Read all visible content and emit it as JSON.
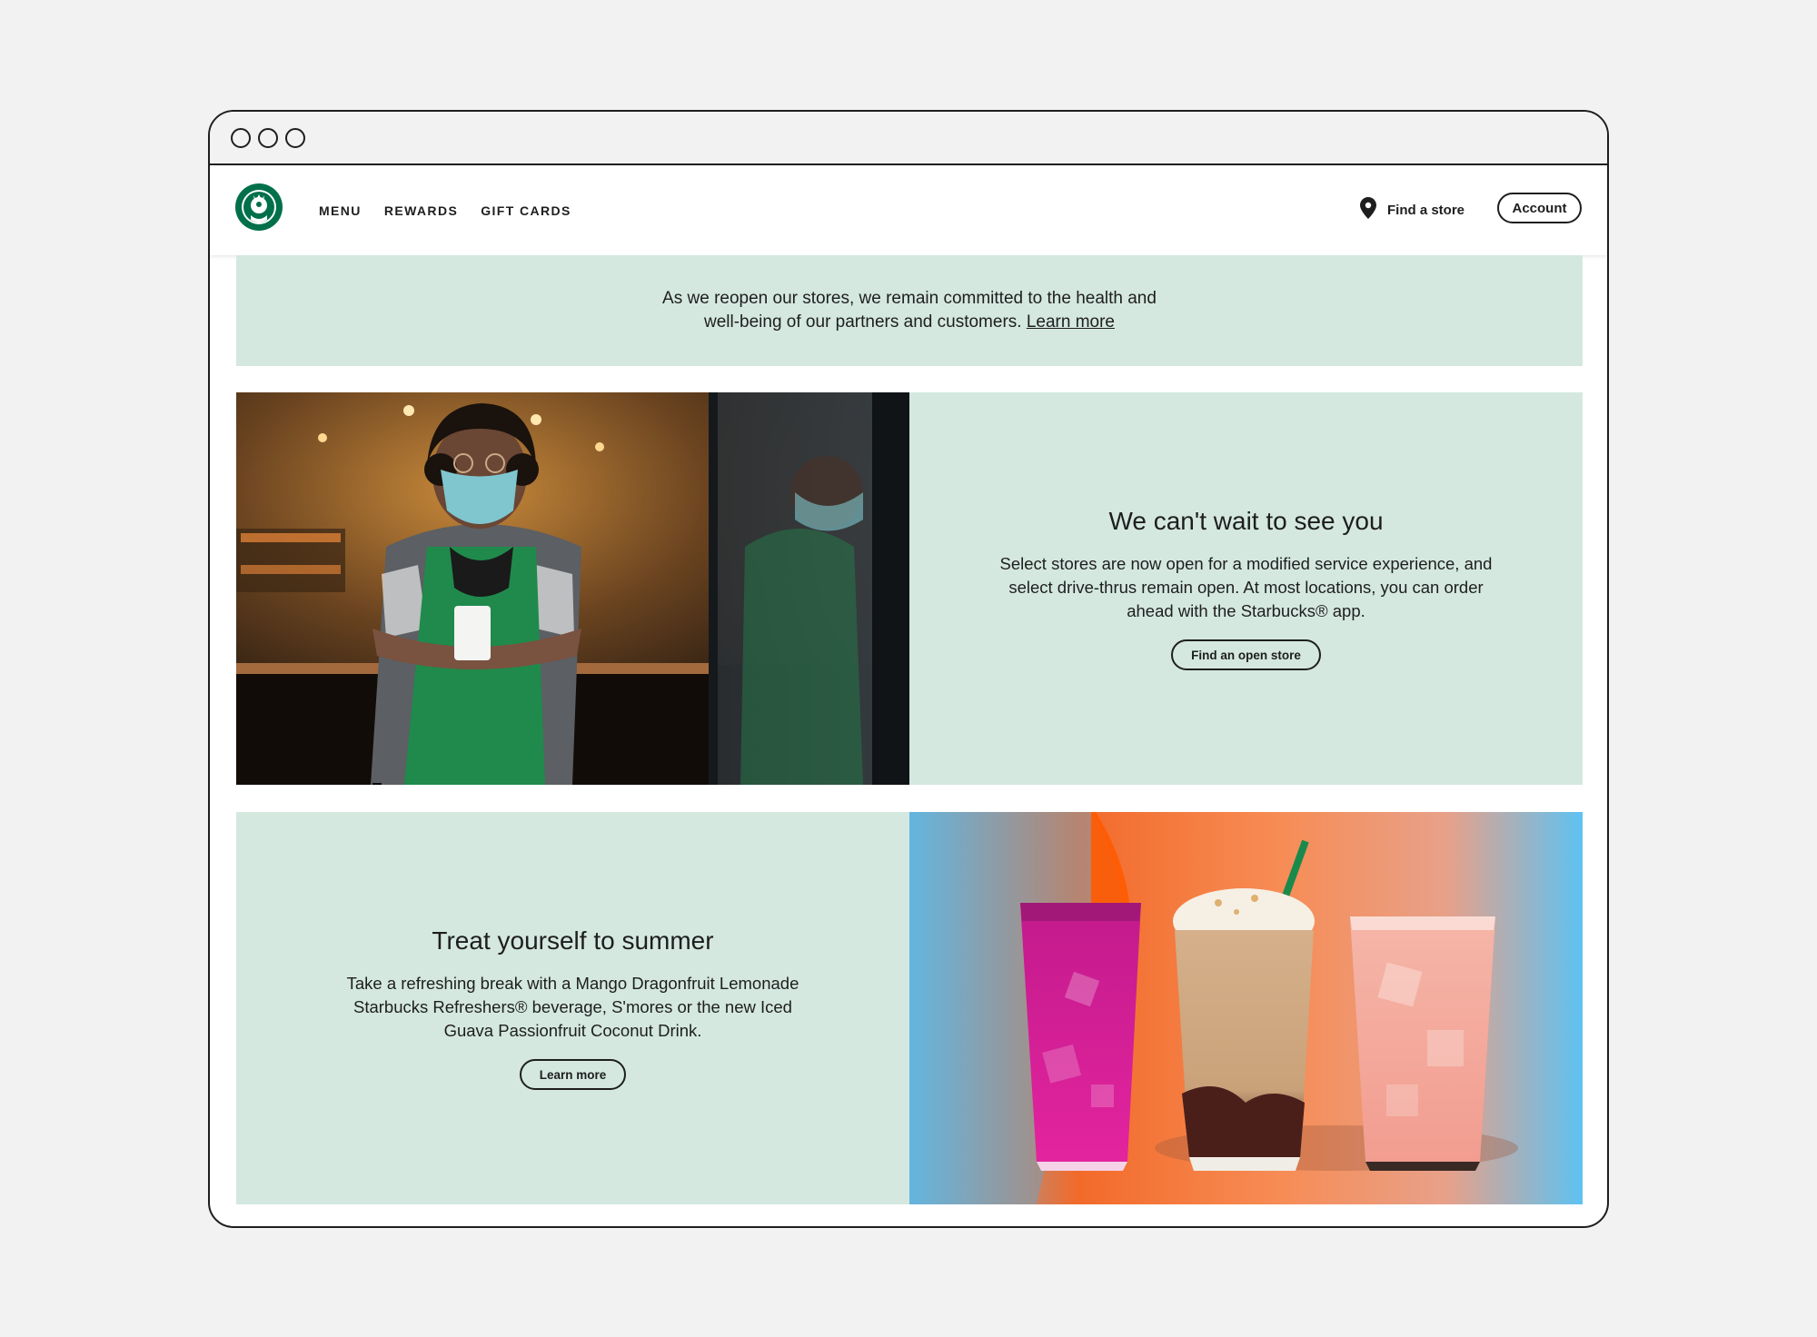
{
  "browser": {
    "window_dots": [
      "close",
      "minimize",
      "maximize"
    ]
  },
  "nav": {
    "logo_icon": "starbucks-siren-logo",
    "links": [
      "MENU",
      "REWARDS",
      "GIFT CARDS"
    ],
    "find_store": {
      "icon": "location-pin-icon",
      "label": "Find a store"
    },
    "account_label": "Account"
  },
  "notice": {
    "text": "As we reopen our stores, we remain committed to the health and well-being of our partners and customers.",
    "link": "Learn more"
  },
  "reopen": {
    "image": "barista-with-mask-photo",
    "title": "We can't wait to see you",
    "body": "Select stores are now open for a modified service experience, and select drive-thrus remain open. At most locations, you can order ahead with the Starbucks® app.",
    "cta": "Find an open store"
  },
  "summer": {
    "title": "Treat yourself to summer",
    "body": "Take a refreshing break with a Mango Dragonfruit Lemonade Starbucks Refreshers® beverage, S'mores or the new Iced Guava Passionfruit Coconut Drink.",
    "cta": "Learn more",
    "image": "three-summer-drinks-photo"
  },
  "colors": {
    "background": "#f2f2f2",
    "panel_mint": "#d4e8e0",
    "brand_green": "#00704a",
    "text": "#1e1e1e"
  }
}
